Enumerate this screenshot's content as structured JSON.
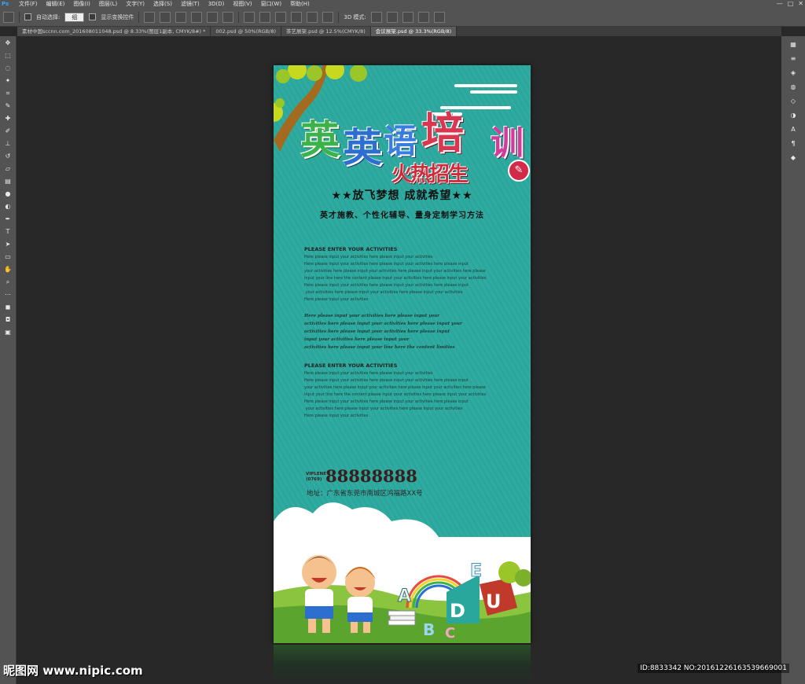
{
  "app": {
    "logo": "Ps"
  },
  "menubar": {
    "items": [
      "文件(F)",
      "编辑(E)",
      "图像(I)",
      "图层(L)",
      "文字(Y)",
      "选择(S)",
      "滤镜(T)",
      "3D(D)",
      "视图(V)",
      "窗口(W)",
      "帮助(H)"
    ],
    "window_controls": [
      "—",
      "□",
      "✕"
    ]
  },
  "options_bar": {
    "auto_select_label": "自动选择:",
    "auto_select_value": "组",
    "show_transform_label": "显示变换控件",
    "mode_3d_label": "3D 模式:"
  },
  "tabs": [
    {
      "label": "素材中国sccnn.com_20160801104​8.psd @ 8.33%(图层1副本, CMYK/8#) *",
      "active": false
    },
    {
      "label": "002.psd @ 50%(RGB/8)",
      "active": false
    },
    {
      "label": "茶艺展架.psd @ 12.5%(CMYK/8)",
      "active": false
    },
    {
      "label": "会议展架.psd @ 33.3%(RGB/8)",
      "active": true
    }
  ],
  "poster": {
    "title_chars": [
      "英",
      "语",
      "培",
      "训"
    ],
    "subtitle": "火热招生",
    "slogan": "★★放飞梦想 成就希望★★",
    "slogan2": "英才施教、个性化辅导、量身定制学习方法",
    "section1": {
      "title": "PLEASE ENTER YOUR ACTIVITIES",
      "lines": [
        "Here please input your activities here please input your activities",
        "Here please input your activities here please input your activities here please input",
        "your activities here please input your activities here please input your activities here please",
        "input your line here the content please input your activities here please input your activities",
        "Here please input your activities here please input your activities here please input",
        " your activities here please input your activities here please input your activities",
        "Here please input your activities"
      ]
    },
    "italic_block": [
      "Here please input your activities here please input your",
      "activities here please input your activities here please input your",
      "activities here please input your activities here please input",
      "input your activities here please input your",
      "activities here please input your line here the content limities"
    ],
    "section2": {
      "title": "PLEASE ENTER YOUR ACTIVITIES",
      "lines": [
        "Here please input your activities here please input your activities",
        "Here please input your activities here please input your activities here please input",
        "your activities here please input your activities here please input your activities here please",
        "input your line here the content please input your activities here please input your activities",
        "Here please input your activities here please input your activities here please input",
        " your activities here please input your activities here please input your activities",
        "Here please input your activities"
      ]
    },
    "phone_label_line1": "VIPLENE",
    "phone_label_line2": "(0769)",
    "phone": "88888888",
    "address": "地址：广东省东莞市南城区鸿福路XX号"
  },
  "watermark": {
    "left": "昵图网 www.nipic.com",
    "right": "ID:8833342 NO:20161226163539669001"
  },
  "colors": {
    "poster_bg": "#2aa79c",
    "ui_panel": "#535353",
    "canvas": "#282828"
  }
}
